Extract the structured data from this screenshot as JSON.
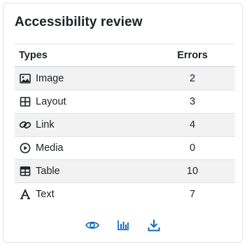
{
  "block": {
    "title": "Accessibility review"
  },
  "table": {
    "headers": {
      "types": "Types",
      "errors": "Errors"
    },
    "rows": [
      {
        "label": "Image",
        "errors": "2",
        "icon": "image-icon"
      },
      {
        "label": "Layout",
        "errors": "3",
        "icon": "layout-icon"
      },
      {
        "label": "Link",
        "errors": "4",
        "icon": "link-icon"
      },
      {
        "label": "Media",
        "errors": "0",
        "icon": "media-play-icon"
      },
      {
        "label": "Table",
        "errors": "10",
        "icon": "table-icon"
      },
      {
        "label": "Text",
        "errors": "7",
        "icon": "text-font-icon"
      }
    ]
  },
  "actions": [
    {
      "icon": "eye-icon"
    },
    {
      "icon": "bar-chart-icon"
    },
    {
      "icon": "download-icon"
    }
  ],
  "colors": {
    "accent": "#0f6cbf",
    "icon_dark": "#1d2125",
    "stripe": "#f2f2f2",
    "border": "#dee2e6"
  }
}
